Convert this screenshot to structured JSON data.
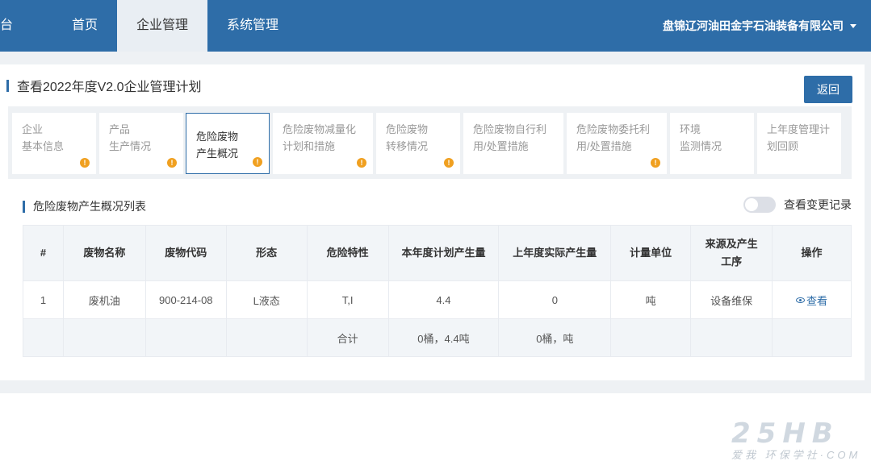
{
  "nav": {
    "brand": "台",
    "items": [
      {
        "label": "首页"
      },
      {
        "label": "企业管理"
      },
      {
        "label": "系统管理"
      }
    ],
    "company": "盘锦辽河油田金宇石油装备有限公司"
  },
  "page": {
    "title": "查看2022年度V2.0企业管理计划",
    "back_label": "返回"
  },
  "tabs": [
    {
      "line1": "企业",
      "line2": "基本信息",
      "warn": "!"
    },
    {
      "line1": "产品",
      "line2": "生产情况",
      "warn": "!"
    },
    {
      "line1": "危险废物",
      "line2": "产生概况",
      "warn": "!"
    },
    {
      "line1": "危险废物减量化",
      "line2": "计划和措施",
      "warn": "!"
    },
    {
      "line1": "危险废物",
      "line2": "转移情况",
      "warn": "!"
    },
    {
      "line1": "危险废物自行利",
      "line2": "用/处置措施",
      "warn": ""
    },
    {
      "line1": "危险废物委托利",
      "line2": "用/处置措施",
      "warn": "!"
    },
    {
      "line1": "环境",
      "line2": "监测情况",
      "warn": ""
    },
    {
      "line1": "上年度管理计",
      "line2": "划回顾",
      "warn": ""
    }
  ],
  "section": {
    "title": "危险废物产生概况列表",
    "toggle_label": "查看变更记录"
  },
  "table": {
    "headers": [
      "#",
      "废物名称",
      "废物代码",
      "形态",
      "危险特性",
      "本年度计划产生量",
      "上年度实际产生量",
      "计量单位",
      "来源及产生",
      "工序",
      "操作"
    ],
    "rows": [
      [
        "1",
        "废机油",
        "900-214-08",
        "L液态",
        "T,I",
        "4.4",
        "0",
        "吨",
        "设备维保",
        "查看"
      ]
    ],
    "summary": {
      "label": "合计",
      "plan_total": "0桶，4.4吨",
      "last_total": "0桶，吨"
    }
  },
  "watermark": {
    "big": "25HB",
    "small": "环保学社·COM",
    "badge": "爱我"
  },
  "colors": {
    "primary": "#2e6da8",
    "warn": "#f0a020",
    "background": "#eef1f4"
  }
}
